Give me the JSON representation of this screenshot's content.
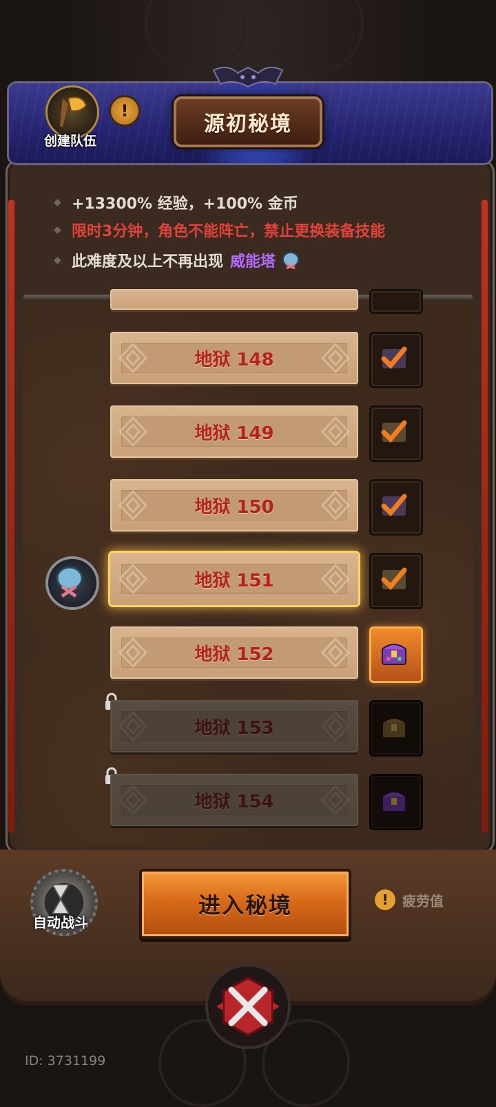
{
  "header": {
    "title": "源初秘境",
    "team_label": "创建队伍",
    "info_glyph": "!"
  },
  "info": {
    "reward": "+13300% 经验，+100% 金币",
    "rule": "限时3分钟，角色不能阵亡，禁止更换装备技能",
    "note": "此难度及以上不再出现",
    "note_highlight": "威能塔"
  },
  "levels": [
    {
      "label": "地狱 148",
      "state": "cleared"
    },
    {
      "label": "地狱 149",
      "state": "cleared"
    },
    {
      "label": "地狱 150",
      "state": "cleared"
    },
    {
      "label": "地狱 151",
      "state": "current"
    },
    {
      "label": "地狱 152",
      "state": "unlocked"
    },
    {
      "label": "地狱 153",
      "state": "locked"
    },
    {
      "label": "地狱 154",
      "state": "locked"
    }
  ],
  "controls": {
    "auto_battle_label": "自动战斗",
    "enter_label": "进入秘境",
    "fatigue_label": "疲劳值",
    "fatigue_glyph": "!"
  },
  "footer": {
    "player_id": "ID: 3731199"
  },
  "colors": {
    "level_text": "#b2231f",
    "rule_text": "#e1433b",
    "highlight_purple": "#b36bff",
    "enter_button": "#d86a1a"
  }
}
